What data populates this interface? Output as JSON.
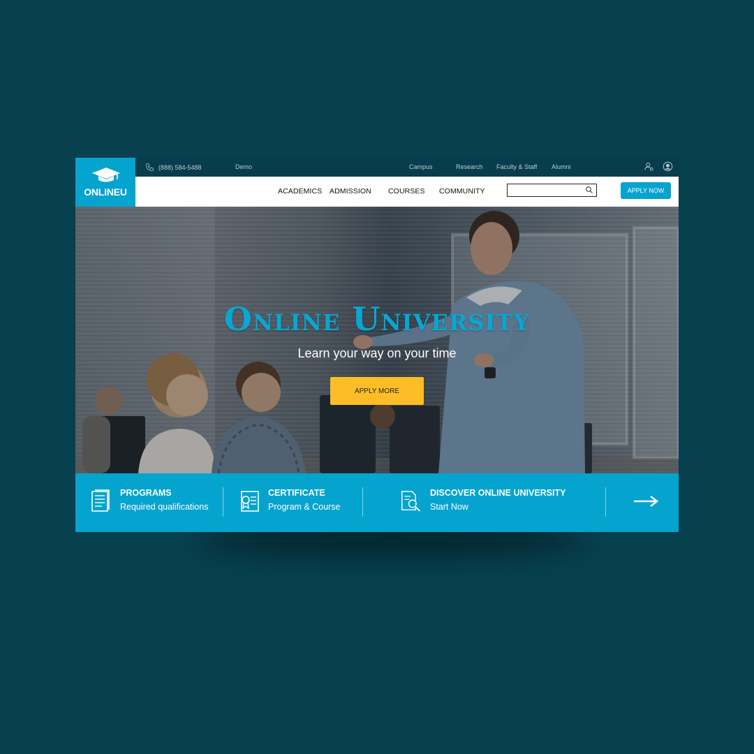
{
  "logo": {
    "text": "ONLINEU"
  },
  "topbar": {
    "phone": "(888) 584-5488",
    "demo": "Demo",
    "links": [
      "Campus",
      "Research",
      "Faculty & Staff",
      "Alumni"
    ]
  },
  "nav": {
    "items": [
      "ACADEMICS",
      "ADMISSION",
      "COURSES",
      "COMMUNITY"
    ],
    "search_placeholder": "",
    "apply_now": "APPLY NOW"
  },
  "hero": {
    "title": "Online University",
    "subtitle": "Learn your way on your time",
    "cta": "APPLY MORE"
  },
  "features": [
    {
      "title": "PROGRAMS",
      "subtitle": "Required qualifications",
      "icon": "book-icon"
    },
    {
      "title": "CERTIFICATE",
      "subtitle": "Program & Course",
      "icon": "certificate-icon"
    },
    {
      "title": "DISCOVER ONLINE UNIVERSITY",
      "subtitle": "Start Now",
      "icon": "document-search-icon"
    }
  ],
  "colors": {
    "background": "#07404f",
    "brand": "#05a4cf",
    "topbar": "#073d4c",
    "cta": "#fcbd27"
  }
}
